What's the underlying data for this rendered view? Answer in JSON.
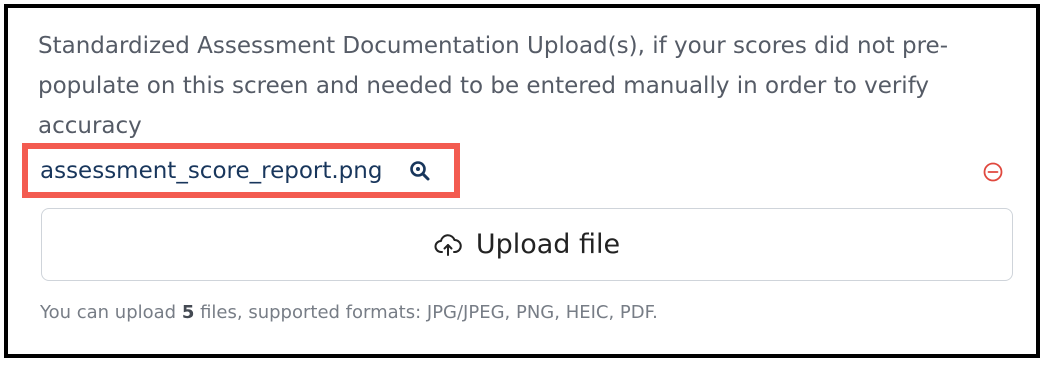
{
  "question": {
    "label": "Standardized Assessment Documentation Upload(s), if your scores did not pre-populate on this screen and needed to be entered manually in order to verify accuracy"
  },
  "uploaded_file": {
    "name": "assessment_score_report.png",
    "preview_icon": "magnifier-icon",
    "remove_icon": "minus-circle-icon"
  },
  "upload_button": {
    "label": "Upload file",
    "icon": "cloud-upload-icon"
  },
  "helper": {
    "prefix": "You can upload ",
    "max_files": "5",
    "suffix": " files, supported formats: JPG/JPEG, PNG, HEIC, PDF."
  },
  "colors": {
    "highlight": "#f35b50",
    "link": "#18365c",
    "remove": "#e0483e",
    "text": "#555b66"
  }
}
